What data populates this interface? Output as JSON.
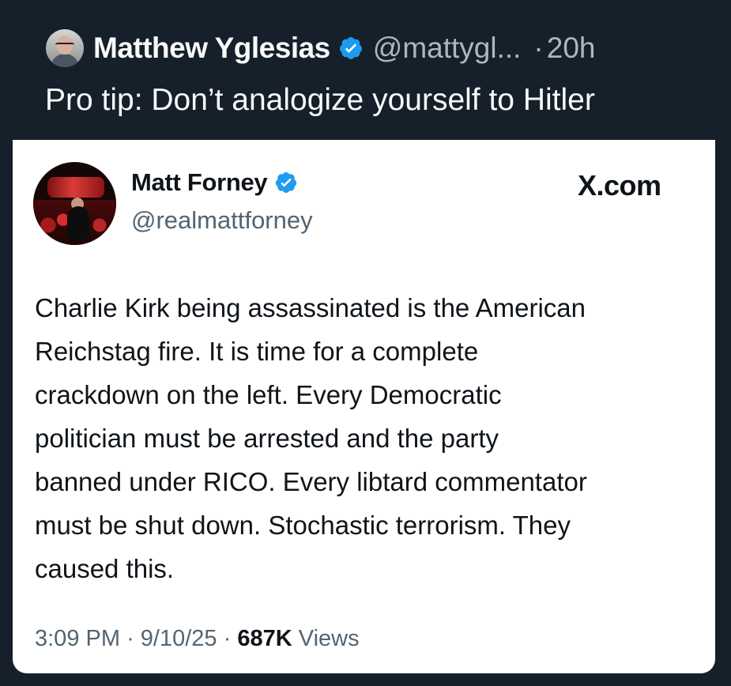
{
  "post": {
    "display_name": "Matthew Yglesias",
    "handle": "@mattygl...",
    "dot": "·",
    "time": "20h",
    "text": "Pro tip: Don’t analogize yourself to Hitler"
  },
  "quoted_post": {
    "display_name": "Matt Forney",
    "handle": "@realmattforney",
    "source": "X.com",
    "text": "Charlie Kirk being assassinated is the American\nReichstag fire. It is time for a complete\ncrackdown on the left. Every Democratic\npolitician must be arrested and the party\nbanned under RICO. Every libtard commentator\nmust be shut down. Stochastic terrorism. They\ncaused this.",
    "time": "3:09 PM",
    "separator_1": "·",
    "date": "9/10/25",
    "separator_2": "·",
    "views_count": "687K",
    "views_label": "Views"
  },
  "colors": {
    "background": "#15202b",
    "primary_text_dark_bg": "#f7f9f9",
    "secondary_text_dark_bg": "#aab8c2",
    "card_background": "#ffffff",
    "card_text": "#0f1419",
    "card_secondary_text": "#536471",
    "verified_blue": "#1d9bf0"
  },
  "icons": {
    "post_avatar": "profile-photo",
    "verified": "verified-badge-icon",
    "quoted_avatar": "profile-photo"
  }
}
